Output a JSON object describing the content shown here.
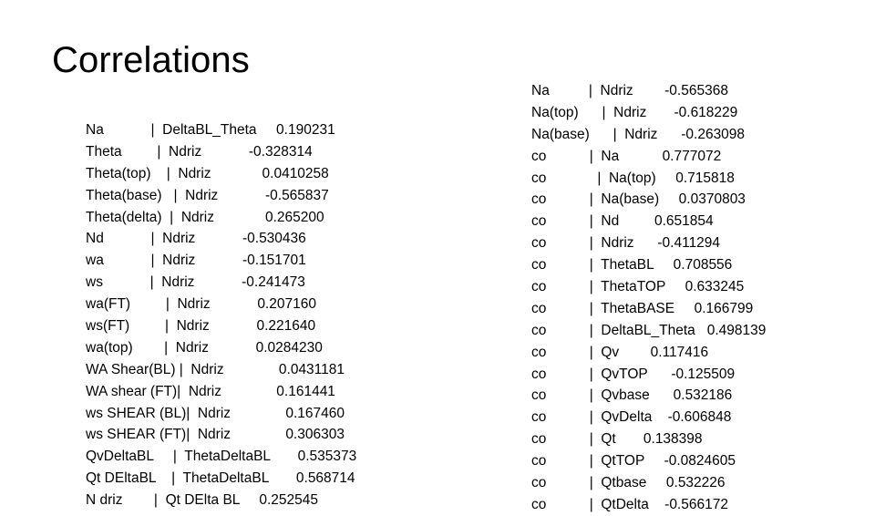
{
  "slide": {
    "title": "Correlations",
    "background_color": "#FFFFFF",
    "text_color": "#000000"
  },
  "left_block": {
    "lines": [
      "Na            |  DeltaBL_Theta     0.190231",
      "Theta         |  Ndriz            -0.328314",
      "Theta(top)    |  Ndriz             0.0410258",
      "Theta(base)   |  Ndriz            -0.565837",
      "Theta(delta)  |  Ndriz             0.265200",
      "Nd            |  Ndriz            -0.530436",
      "wa            |  Ndriz            -0.151701",
      "ws            |  Ndriz            -0.241473",
      "wa(FT)         |  Ndriz            0.207160",
      "ws(FT)         |  Ndriz            0.221640",
      "wa(top)        |  Ndriz            0.0284230",
      "WA Shear(BL) |  Ndriz              0.0431181",
      "WA shear (FT)|  Ndriz              0.161441",
      "ws SHEAR (BL)|  Ndriz              0.167460",
      "ws SHEAR (FT)|  Ndriz              0.306303",
      "QvDeltaBL     |  ThetaDeltaBL       0.535373",
      "Qt DEltaBL    |  ThetaDeltaBL       0.568714",
      "N driz        |  Qt DElta BL     0.252545"
    ],
    "rows": [
      {
        "var1": "Na",
        "var2": "DeltaBL_Theta",
        "value": "0.190231"
      },
      {
        "var1": "Theta",
        "var2": "Ndriz",
        "value": "-0.328314"
      },
      {
        "var1": "Theta(top)",
        "var2": "Ndriz",
        "value": "0.0410258"
      },
      {
        "var1": "Theta(base)",
        "var2": "Ndriz",
        "value": "-0.565837"
      },
      {
        "var1": "Theta(delta)",
        "var2": "Ndriz",
        "value": "0.265200"
      },
      {
        "var1": "Nd",
        "var2": "Ndriz",
        "value": "-0.530436"
      },
      {
        "var1": "wa",
        "var2": "Ndriz",
        "value": "-0.151701"
      },
      {
        "var1": "ws",
        "var2": "Ndriz",
        "value": "-0.241473"
      },
      {
        "var1": "wa(FT)",
        "var2": "Ndriz",
        "value": "0.207160"
      },
      {
        "var1": "ws(FT)",
        "var2": "Ndriz",
        "value": "0.221640"
      },
      {
        "var1": "wa(top)",
        "var2": "Ndriz",
        "value": "0.0284230"
      },
      {
        "var1": "WA Shear(BL)",
        "var2": "Ndriz",
        "value": "0.0431181"
      },
      {
        "var1": "WA shear (FT)",
        "var2": "Ndriz",
        "value": "0.161441"
      },
      {
        "var1": "ws SHEAR (BL)",
        "var2": "Ndriz",
        "value": "0.167460"
      },
      {
        "var1": "ws SHEAR (FT)",
        "var2": "Ndriz",
        "value": "0.306303"
      },
      {
        "var1": "QvDeltaBL",
        "var2": "ThetaDeltaBL",
        "value": "0.535373"
      },
      {
        "var1": "Qt DEltaBL",
        "var2": "ThetaDeltaBL",
        "value": "0.568714"
      },
      {
        "var1": "N driz",
        "var2": "Qt DElta BL",
        "value": "0.252545"
      }
    ]
  },
  "right_block": {
    "lines": [
      "Na          |  Ndriz        -0.565368",
      "Na(top)      |  Ndriz       -0.618229",
      "Na(base)      |  Ndriz      -0.263098",
      "co           |  Na           0.777072",
      "co             |  Na(top)     0.715818",
      "co           |  Na(base)     0.0370803",
      "co           |  Nd         0.651854",
      "co           |  Ndriz      -0.411294",
      "co           |  ThetaBL     0.708556",
      "co           |  ThetaTOP     0.633245",
      "co           |  ThetaBASE     0.166799",
      "co           |  DeltaBL_Theta   0.498139",
      "co           |  Qv        0.117416",
      "co           |  QvTOP      -0.125509",
      "co           |  Qvbase      0.532186",
      "co           |  QvDelta    -0.606848",
      "co           |  Qt       0.138398",
      "co           |  QtTOP     -0.0824605",
      "co           |  Qtbase     0.532226",
      "co           |  QtDelta    -0.566172"
    ],
    "rows": [
      {
        "var1": "Na",
        "var2": "Ndriz",
        "value": "-0.565368"
      },
      {
        "var1": "Na(top)",
        "var2": "Ndriz",
        "value": "-0.618229"
      },
      {
        "var1": "Na(base)",
        "var2": "Ndriz",
        "value": "-0.263098"
      },
      {
        "var1": "co",
        "var2": "Na",
        "value": "0.777072"
      },
      {
        "var1": "co",
        "var2": "Na(top)",
        "value": "0.715818"
      },
      {
        "var1": "co",
        "var2": "Na(base)",
        "value": "0.0370803"
      },
      {
        "var1": "co",
        "var2": "Nd",
        "value": "0.651854"
      },
      {
        "var1": "co",
        "var2": "Ndriz",
        "value": "-0.411294"
      },
      {
        "var1": "co",
        "var2": "ThetaBL",
        "value": "0.708556"
      },
      {
        "var1": "co",
        "var2": "ThetaTOP",
        "value": "0.633245"
      },
      {
        "var1": "co",
        "var2": "ThetaBASE",
        "value": "0.166799"
      },
      {
        "var1": "co",
        "var2": "DeltaBL_Theta",
        "value": "0.498139"
      },
      {
        "var1": "co",
        "var2": "Qv",
        "value": "0.117416"
      },
      {
        "var1": "co",
        "var2": "QvTOP",
        "value": "-0.125509"
      },
      {
        "var1": "co",
        "var2": "Qvbase",
        "value": "0.532186"
      },
      {
        "var1": "co",
        "var2": "QvDelta",
        "value": "-0.606848"
      },
      {
        "var1": "co",
        "var2": "Qt",
        "value": "0.138398"
      },
      {
        "var1": "co",
        "var2": "QtTOP",
        "value": "-0.0824605"
      },
      {
        "var1": "co",
        "var2": "Qtbase",
        "value": "0.532226"
      },
      {
        "var1": "co",
        "var2": "QtDelta",
        "value": "-0.566172"
      }
    ]
  }
}
